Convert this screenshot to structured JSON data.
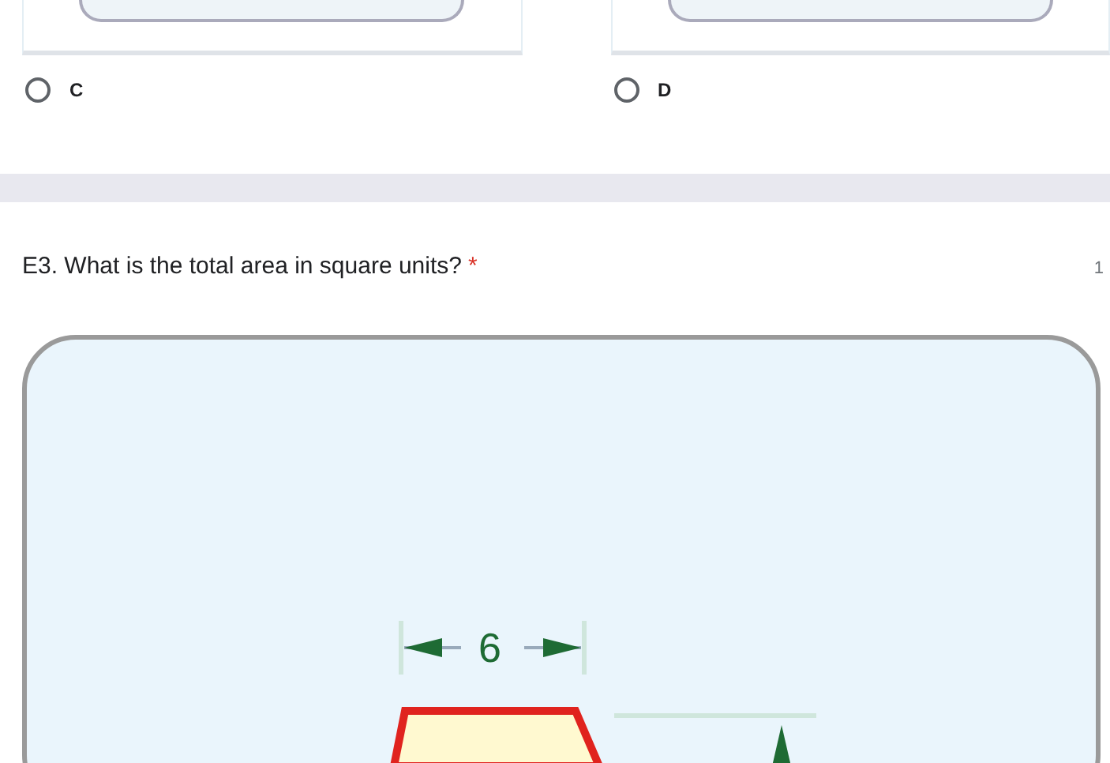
{
  "options": [
    {
      "label": "C",
      "selected": false
    },
    {
      "label": "D",
      "selected": false
    }
  ],
  "question": {
    "title": "E3. What is the total area in square units?",
    "required_mark": "*",
    "points": "1",
    "figure": {
      "dimension_label": "6"
    }
  }
}
